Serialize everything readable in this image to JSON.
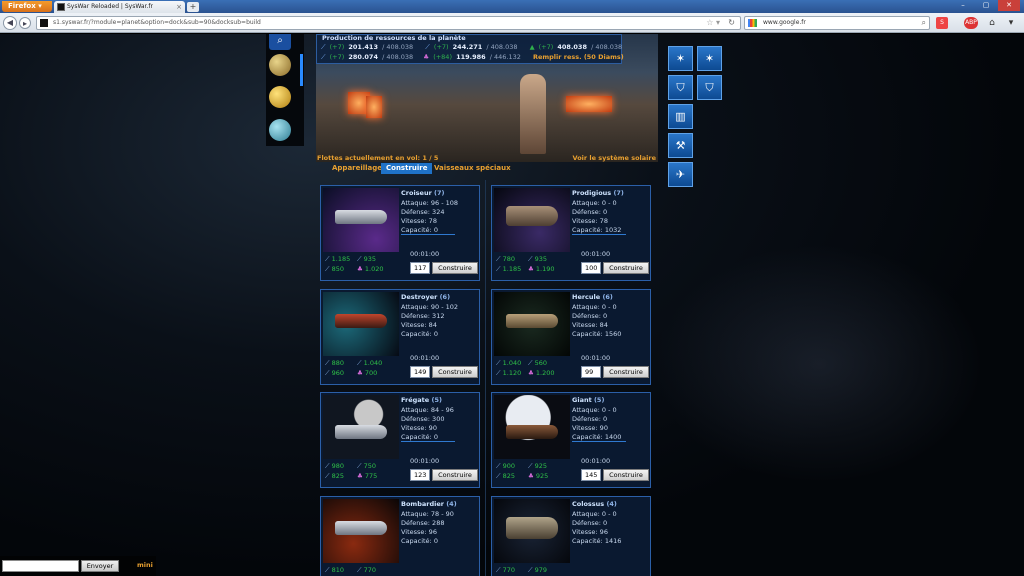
{
  "browser": {
    "app_button": "Firefox",
    "tab_title": "SysWar Reloaded | SysWar.fr",
    "url": "s1.syswar.fr/?module=planet&option=dock&sub=90&docksub=build",
    "search_text": "www.google.fr"
  },
  "resources": {
    "title": "Production de ressources de la planète",
    "r1": {
      "gain": "(+7)",
      "amount": "201.413",
      "max": "/ 408.038"
    },
    "r2": {
      "gain": "(+7)",
      "amount": "244.271",
      "max": "/ 408.038"
    },
    "r3": {
      "gain": "(+7)",
      "amount": "408.038",
      "max": "/ 408.038"
    },
    "r4": {
      "gain": "(+7)",
      "amount": "280.074",
      "max": "/ 408.038"
    },
    "r5": {
      "gain": "(+84)",
      "amount": "119.986",
      "max": "/ 446.132"
    },
    "fill_link": "Remplir ress. (50 Diams)"
  },
  "header": {
    "fleets": "Flottes actuellement en vol: 1 / 5",
    "system_link": "Voir le système solaire"
  },
  "tabs": {
    "t1": "Appareillage",
    "t2": "Construire",
    "t3": "Vaisseaux spéciaux"
  },
  "ships": [
    {
      "name": "Croiseur",
      "count": "(7)",
      "attack": "Attaque: 96 - 108",
      "defense": "Défense: 324",
      "speed": "Vitesse: 78",
      "capacity": "Capacité: 0",
      "c1": "1.185",
      "c2": "935",
      "c3": "850",
      "c4": "1.020",
      "time": "00:01:00",
      "qty": "117",
      "button": "Construire"
    },
    {
      "name": "Prodigious",
      "count": "(7)",
      "attack": "Attaque: 0 - 0",
      "defense": "Défense: 0",
      "speed": "Vitesse: 78",
      "capacity": "Capacité: 1032",
      "c1": "780",
      "c2": "935",
      "c3": "1.185",
      "c4": "1.190",
      "time": "00:01:00",
      "qty": "100",
      "button": "Construire"
    },
    {
      "name": "Destroyer",
      "count": "(6)",
      "attack": "Attaque: 90 - 102",
      "defense": "Défense: 312",
      "speed": "Vitesse: 84",
      "capacity": "Capacité: 0",
      "c1": "880",
      "c2": "1.040",
      "c3": "960",
      "c4": "700",
      "time": "00:01:00",
      "qty": "149",
      "button": "Construire"
    },
    {
      "name": "Hercule",
      "count": "(6)",
      "attack": "Attaque: 0 - 0",
      "defense": "Défense: 0",
      "speed": "Vitesse: 84",
      "capacity": "Capacité: 1560",
      "c1": "1.040",
      "c2": "560",
      "c3": "1.120",
      "c4": "1.200",
      "time": "00:01:00",
      "qty": "99",
      "button": "Construire"
    },
    {
      "name": "Frégate",
      "count": "(5)",
      "attack": "Attaque: 84 - 96",
      "defense": "Défense: 300",
      "speed": "Vitesse: 90",
      "capacity": "Capacité: 0",
      "c1": "980",
      "c2": "750",
      "c3": "825",
      "c4": "775",
      "time": "00:01:00",
      "qty": "123",
      "button": "Construire"
    },
    {
      "name": "Giant",
      "count": "(5)",
      "attack": "Attaque: 0 - 0",
      "defense": "Défense: 0",
      "speed": "Vitesse: 90",
      "capacity": "Capacité: 1400",
      "c1": "900",
      "c2": "925",
      "c3": "825",
      "c4": "925",
      "time": "00:01:00",
      "qty": "145",
      "button": "Construire"
    },
    {
      "name": "Bombardier",
      "count": "(4)",
      "attack": "Attaque: 78 - 90",
      "defense": "Défense: 288",
      "speed": "Vitesse: 96",
      "capacity": "Capacité: 0",
      "c1": "810",
      "c2": "770"
    },
    {
      "name": "Colossus",
      "count": "(4)",
      "attack": "Attaque: 0 - 0",
      "defense": "Défense: 0",
      "speed": "Vitesse: 96",
      "capacity": "Capacité: 1416",
      "c1": "770",
      "c2": "979"
    }
  ],
  "chat": {
    "send": "Envoyer",
    "mini": "mini"
  },
  "colors": {
    "accent": "#e8a030",
    "card_border": "#2b5fa8",
    "active_tab": "#1f72c8",
    "gain_green": "#2fb04c"
  }
}
